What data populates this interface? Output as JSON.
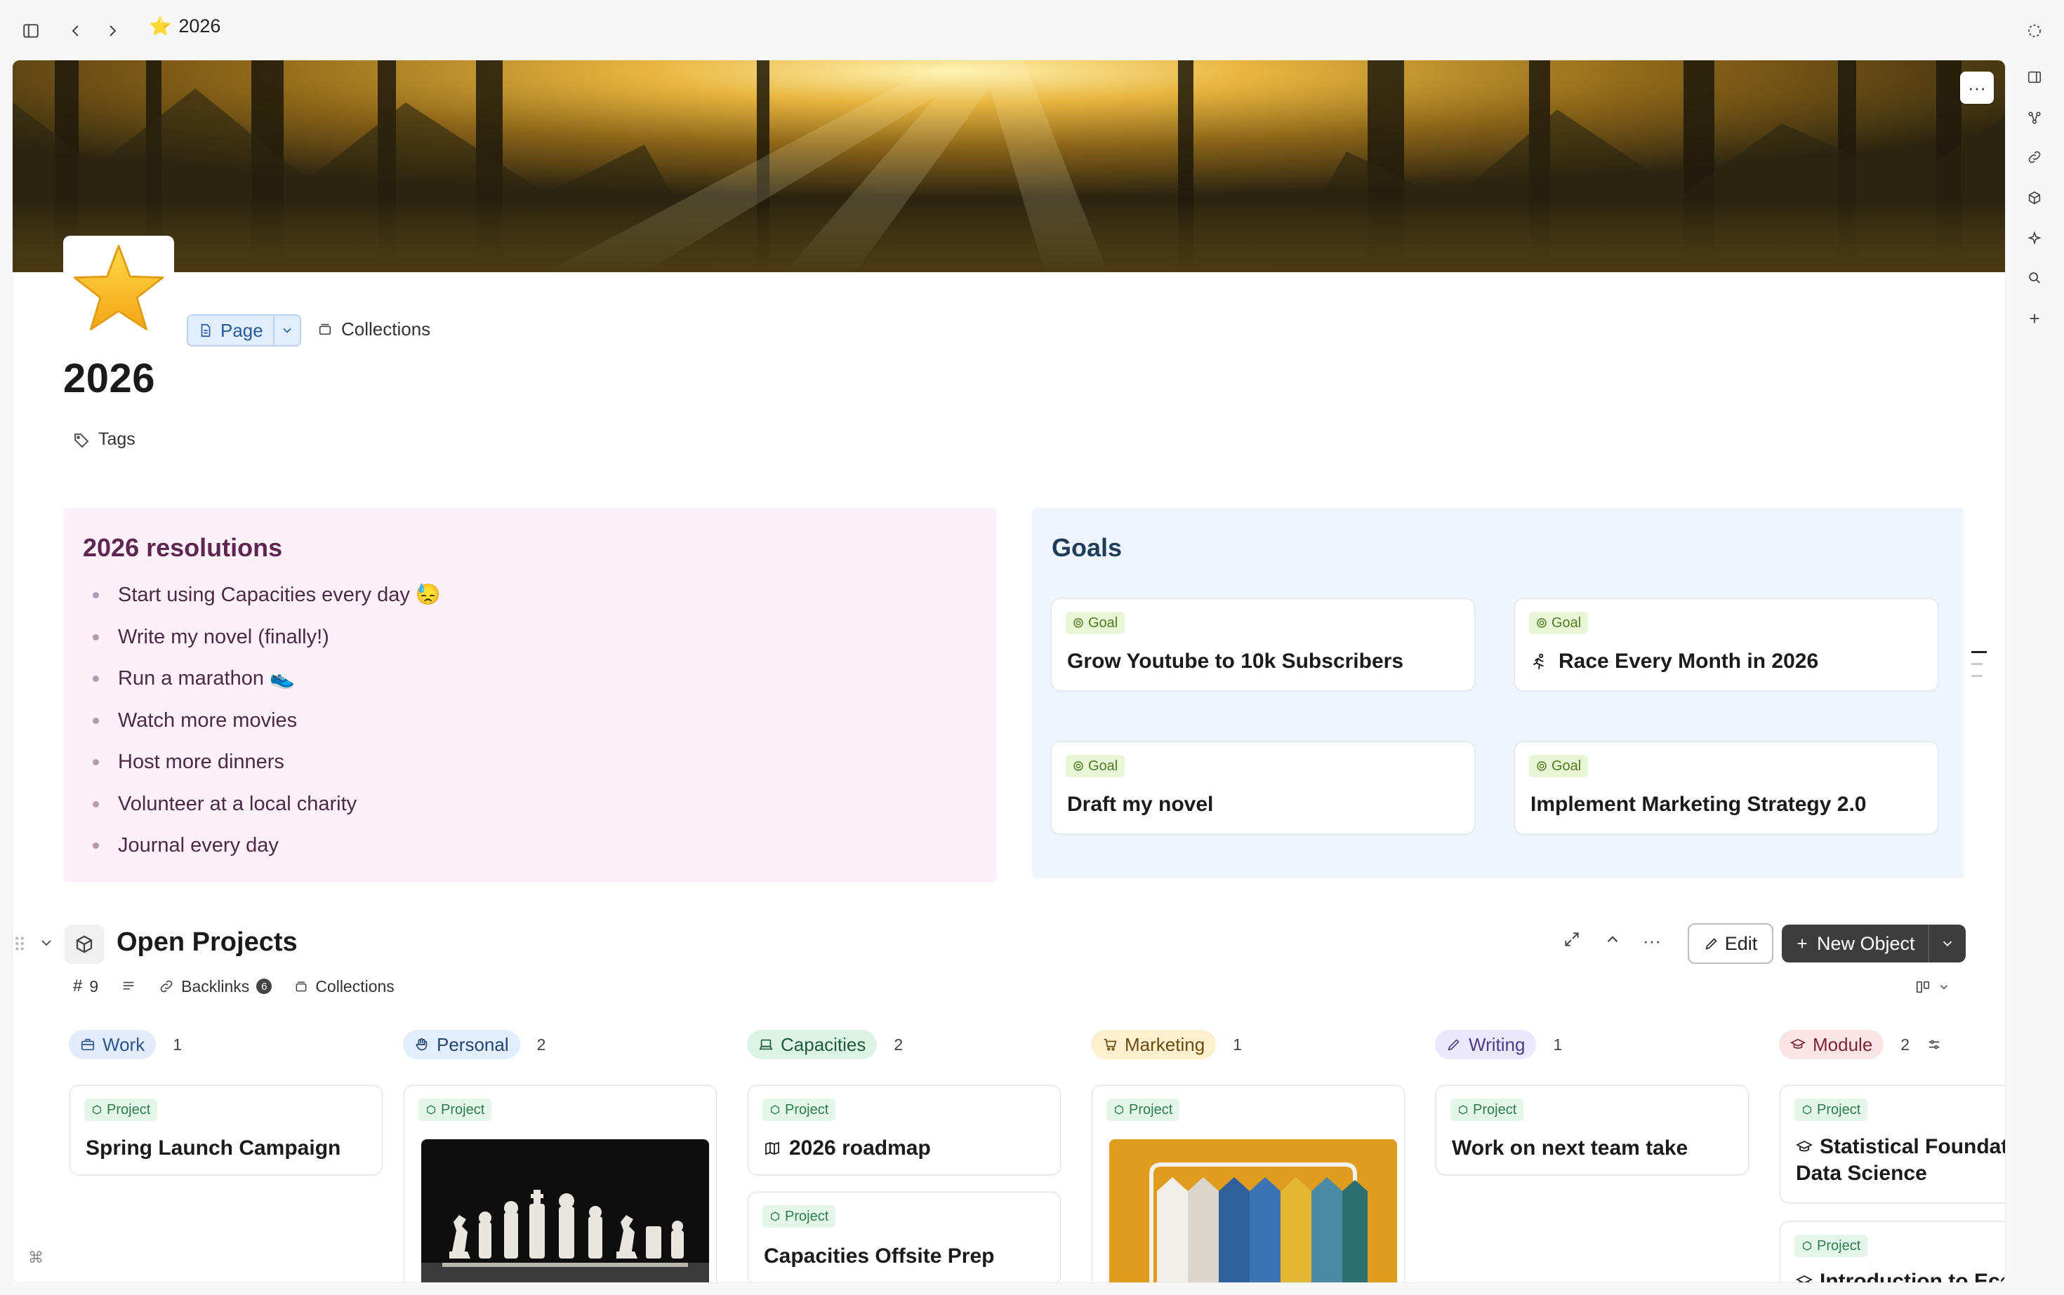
{
  "topbar": {
    "title": "2026"
  },
  "page": {
    "title": "2026",
    "type_label": "Page",
    "collections_label": "Collections",
    "tags_label": "Tags"
  },
  "resolutions": {
    "title": "2026 resolutions",
    "items": [
      "Start using Capacities every day 😓",
      "Write my novel (finally!)",
      "Run a marathon 👟",
      "Watch more movies",
      "Host more dinners",
      "Volunteer at a local charity",
      "Journal every day"
    ]
  },
  "goals": {
    "title": "Goals",
    "tag": "Goal",
    "items": [
      {
        "name": "Grow Youtube to 10k Subscribers",
        "icon": ""
      },
      {
        "name": "Race Every Month in 2026",
        "icon": "runner-icon"
      },
      {
        "name": "Draft my novel",
        "icon": ""
      },
      {
        "name": "Implement Marketing Strategy 2.0",
        "icon": ""
      }
    ]
  },
  "projects": {
    "title": "Open Projects",
    "edit_label": "Edit",
    "new_object_label": "New Object",
    "count": "9",
    "backlinks_label": "Backlinks",
    "backlinks_count": "6",
    "collections_label": "Collections",
    "card_tag": "Project",
    "columns": [
      {
        "name": "Work",
        "count": "1",
        "bg": "#e3ecfa",
        "fg": "#2c5590",
        "cards": [
          "Spring Launch Campaign"
        ]
      },
      {
        "name": "Personal",
        "count": "2",
        "bg": "#e2eefb",
        "fg": "#22466f",
        "cards": []
      },
      {
        "name": "Capacities",
        "count": "2",
        "bg": "#dcf3e6",
        "fg": "#1f5b3a",
        "cards": [
          "2026 roadmap",
          "Capacities Offsite Prep"
        ]
      },
      {
        "name": "Marketing",
        "count": "1",
        "bg": "#fcf0cf",
        "fg": "#6b4a10",
        "cards": []
      },
      {
        "name": "Writing",
        "count": "1",
        "bg": "#ece8fb",
        "fg": "#4b3c8a",
        "cards": [
          "Work on next team take"
        ]
      },
      {
        "name": "Module",
        "count": "2",
        "bg": "#fbe4e6",
        "fg": "#7a2632",
        "cards": [
          "Statistical Foundations for Data Science",
          "Introduction to Economics"
        ]
      }
    ]
  },
  "colors": {
    "accent_dark": "#3d3d3d",
    "resolutions_bg": "#fdf1f9",
    "goals_bg": "#eef5fc",
    "goal_tag_bg": "#e9f5d7",
    "project_tag_bg": "#e4f5ea"
  }
}
